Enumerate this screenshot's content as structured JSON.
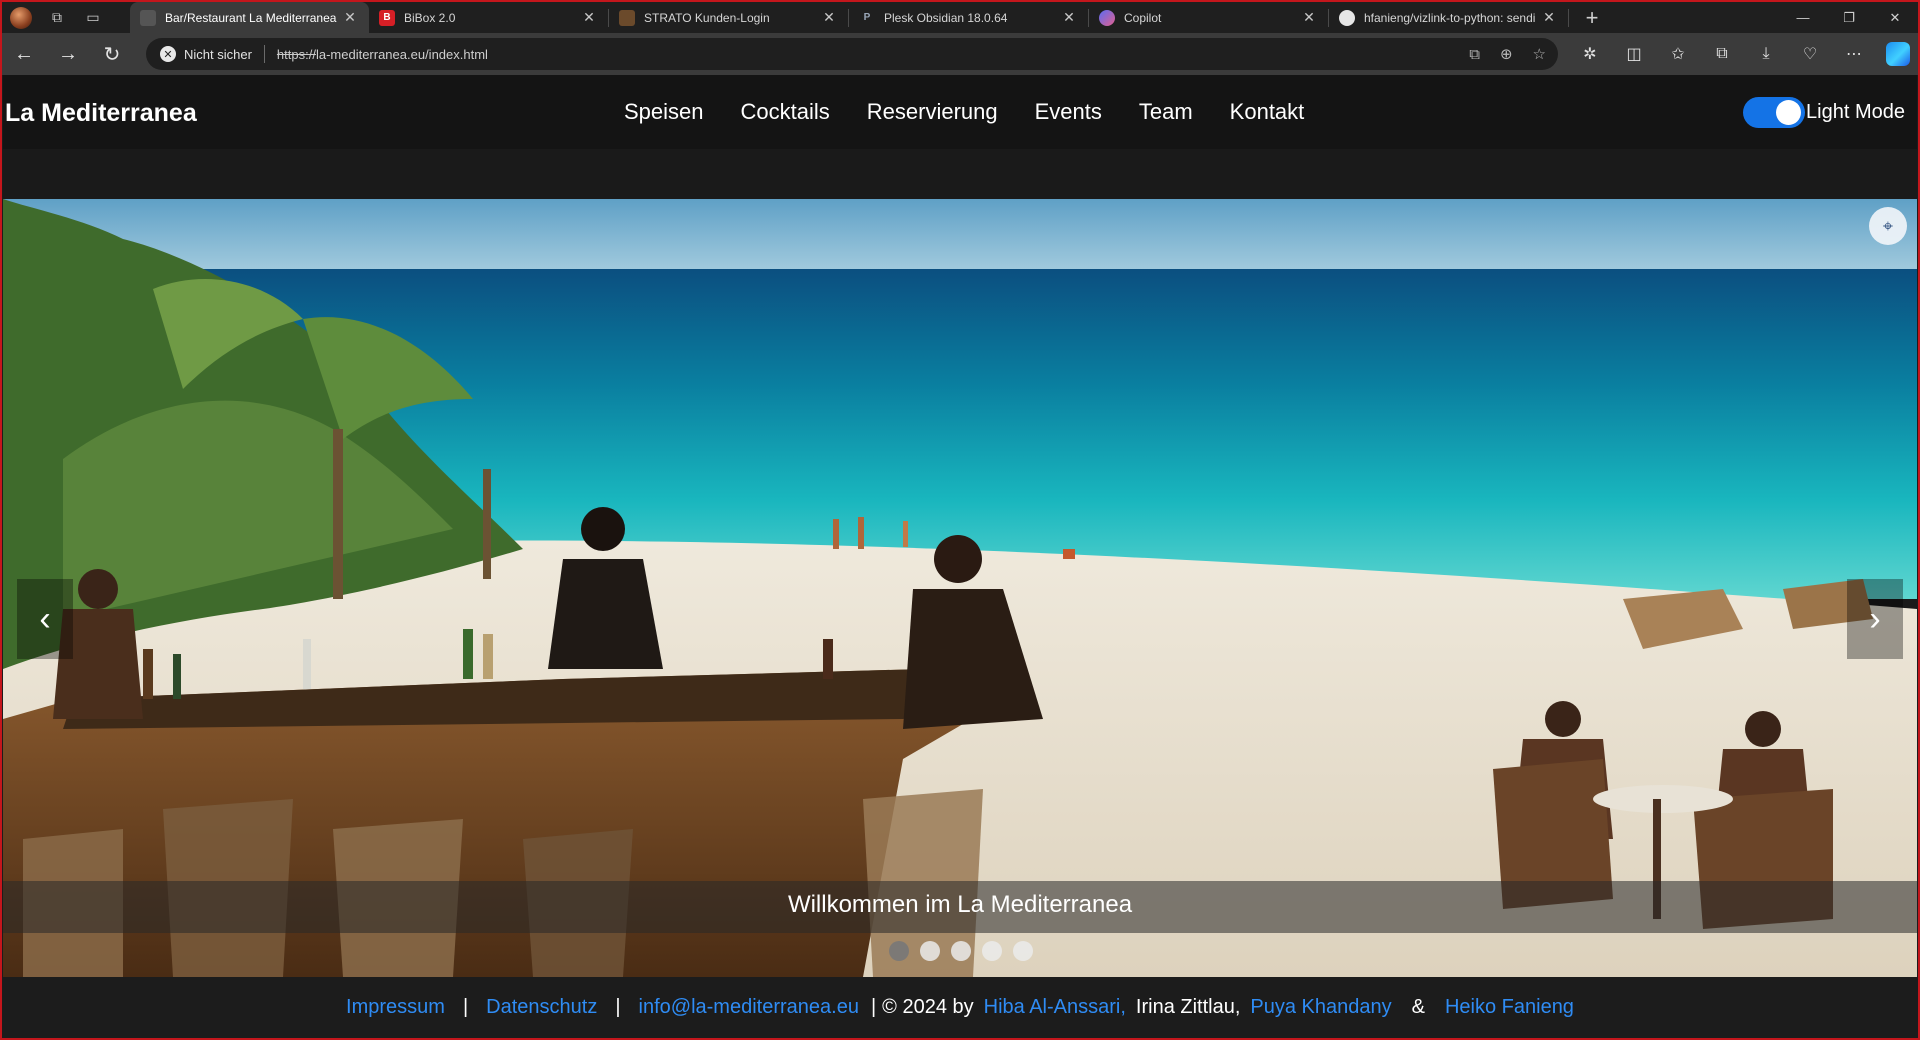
{
  "browser": {
    "tabs": [
      {
        "title": "Bar/Restaurant La Mediterranea",
        "favicon": "page-icon",
        "active": true
      },
      {
        "title": "BiBox 2.0",
        "favicon": "bibox-icon",
        "active": false
      },
      {
        "title": "STRATO Kunden-Login",
        "favicon": "strato-icon",
        "active": false
      },
      {
        "title": "Plesk Obsidian 18.0.64",
        "favicon": "plesk-icon",
        "active": false
      },
      {
        "title": "Copilot",
        "favicon": "copilot-icon",
        "active": false
      },
      {
        "title": "hfanieng/vizlink-to-python: sendi",
        "favicon": "github-icon",
        "active": false
      }
    ],
    "security_label": "Nicht sicher",
    "url_scheme": "https://",
    "url_rest": "la-mediterranea.eu/index.html"
  },
  "site": {
    "brand": "La Mediterranea",
    "nav": [
      "Speisen",
      "Cocktails",
      "Reservierung",
      "Events",
      "Team",
      "Kontakt"
    ],
    "mode_label": "Light Mode",
    "mode_toggle_on": true
  },
  "carousel": {
    "caption": "Willkommen im La Mediterranea",
    "slide_count": 5,
    "active_index": 0,
    "prev_glyph": "‹",
    "next_glyph": "›"
  },
  "footer": {
    "impressum": "Impressum",
    "separator": "|",
    "datenschutz": "Datenschutz",
    "email": "info@la-mediterranea.eu",
    "copyright": "© 2024 by",
    "author1": "Hiba Al-Anssari,",
    "author2": "Irina Zittlau,",
    "author3": "Puya Khandany",
    "ampersand": "&",
    "author4": "Heiko Fanieng"
  },
  "colors": {
    "accent_link": "#2f8cf4",
    "toggle": "#1473e6",
    "frame": "#c4161c"
  }
}
